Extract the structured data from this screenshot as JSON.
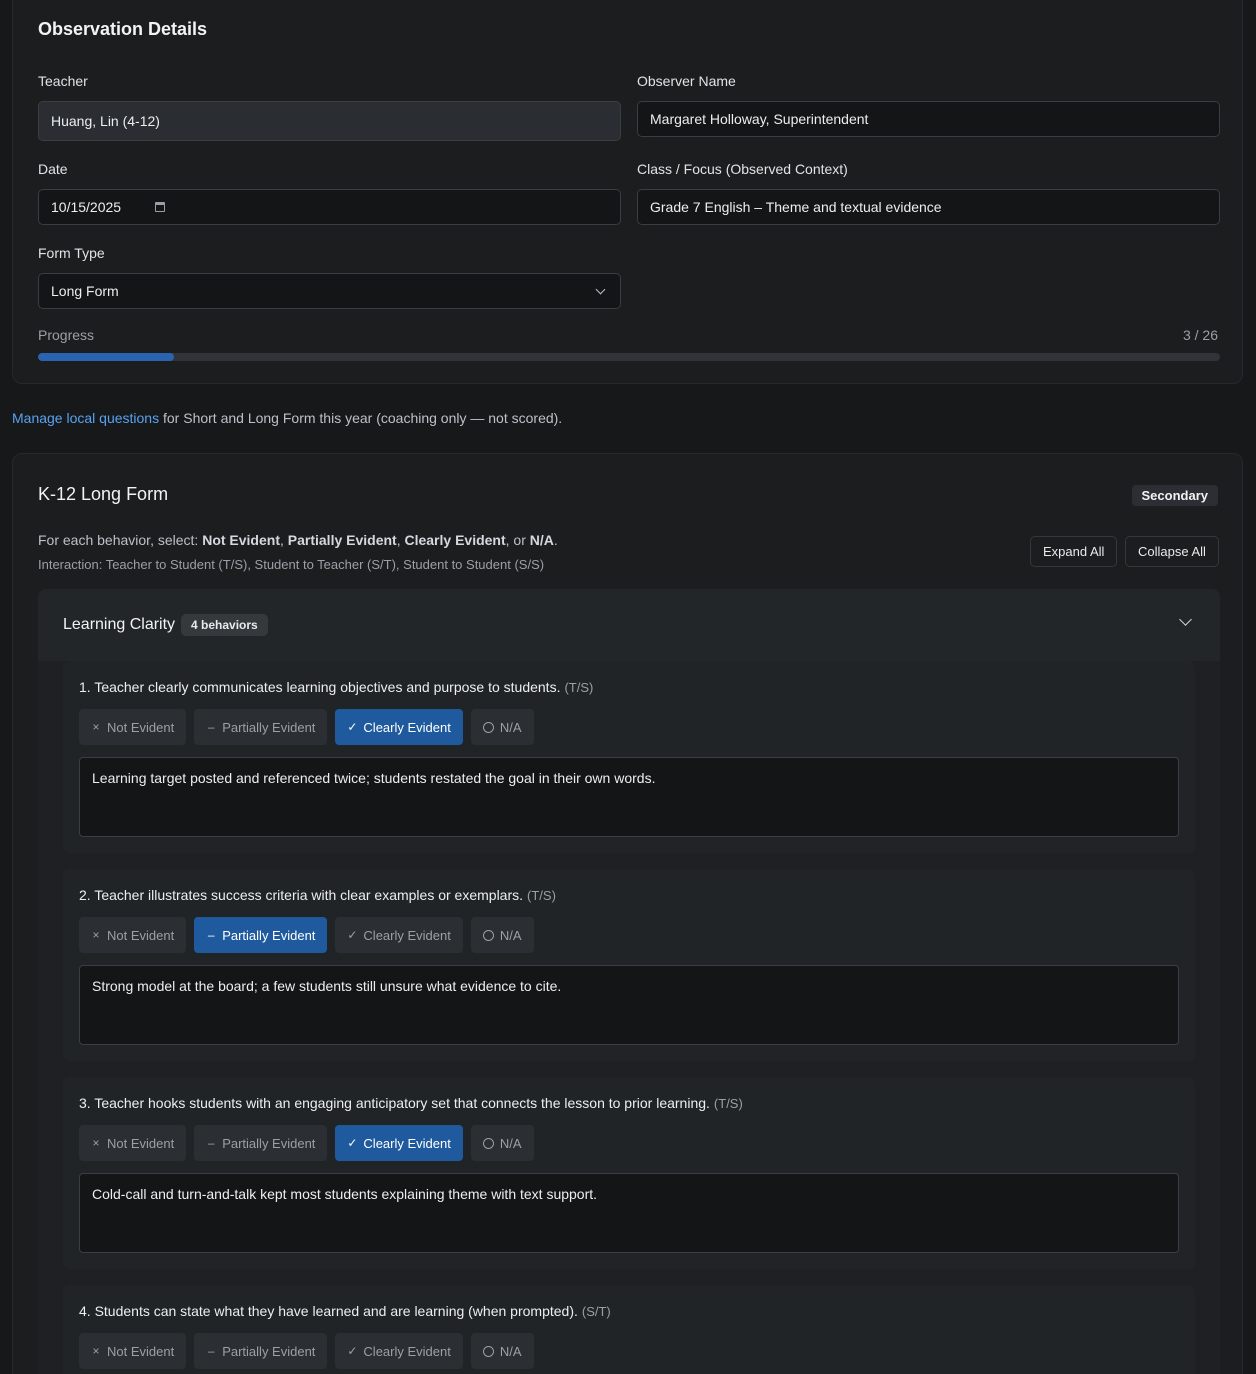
{
  "details": {
    "title": "Observation Details",
    "teacher_label": "Teacher",
    "teacher_value": "Huang, Lin (4-12)",
    "observer_label": "Observer Name",
    "observer_value": "Margaret Holloway, Superintendent",
    "date_label": "Date",
    "date_value": "10/15/2025",
    "class_label": "Class / Focus (Observed Context)",
    "class_value": "Grade 7 English – Theme and textual evidence",
    "form_type_label": "Form Type",
    "form_type_value": "Long Form",
    "progress_label": "Progress",
    "progress_text": "3 / 26",
    "progress_completed": 3,
    "progress_total": 26
  },
  "info": {
    "link_text": "Manage local questions",
    "rest_text": " for Short and Long Form this year (coaching only — not scored)."
  },
  "form": {
    "title": "K-12 Long Form",
    "badge": "Secondary",
    "instr_prefix": "For each behavior, select: ",
    "opt_not": "Not Evident",
    "sep1": ", ",
    "opt_partial": "Partially Evident",
    "sep2": ", ",
    "opt_clear": "Clearly Evident",
    "sep3": ", or ",
    "opt_na": "N/A",
    "instr_end": ".",
    "interaction_note": "Interaction: Teacher to Student (T/S), Student to Teacher (S/T), Student to Student (S/S)",
    "expand_all": "Expand All",
    "collapse_all": "Collapse All"
  },
  "section": {
    "title": "Learning Clarity",
    "count": "4 behaviors"
  },
  "option_labels": {
    "not": "Not Evident",
    "partial": "Partially Evident",
    "clear": "Clearly Evident",
    "na": "N/A"
  },
  "behaviors": [
    {
      "text": "1. Teacher clearly communicates learning objectives and purpose to students.",
      "interaction": "(T/S)",
      "selected": "clear",
      "notes": "Learning target posted and referenced twice; students restated the goal in their own words."
    },
    {
      "text": "2. Teacher illustrates success criteria with clear examples or exemplars.",
      "interaction": "(T/S)",
      "selected": "partial",
      "notes": "Strong model at the board; a few students still unsure what evidence to cite."
    },
    {
      "text": "3. Teacher hooks students with an engaging anticipatory set that connects the lesson to prior learning.",
      "interaction": "(T/S)",
      "selected": "clear",
      "notes": "Cold-call and turn-and-talk kept most students explaining theme with text support."
    },
    {
      "text": "4. Students can state what they have learned and are learning (when prompted).",
      "interaction": "(S/T)",
      "selected": "",
      "notes": ""
    }
  ]
}
